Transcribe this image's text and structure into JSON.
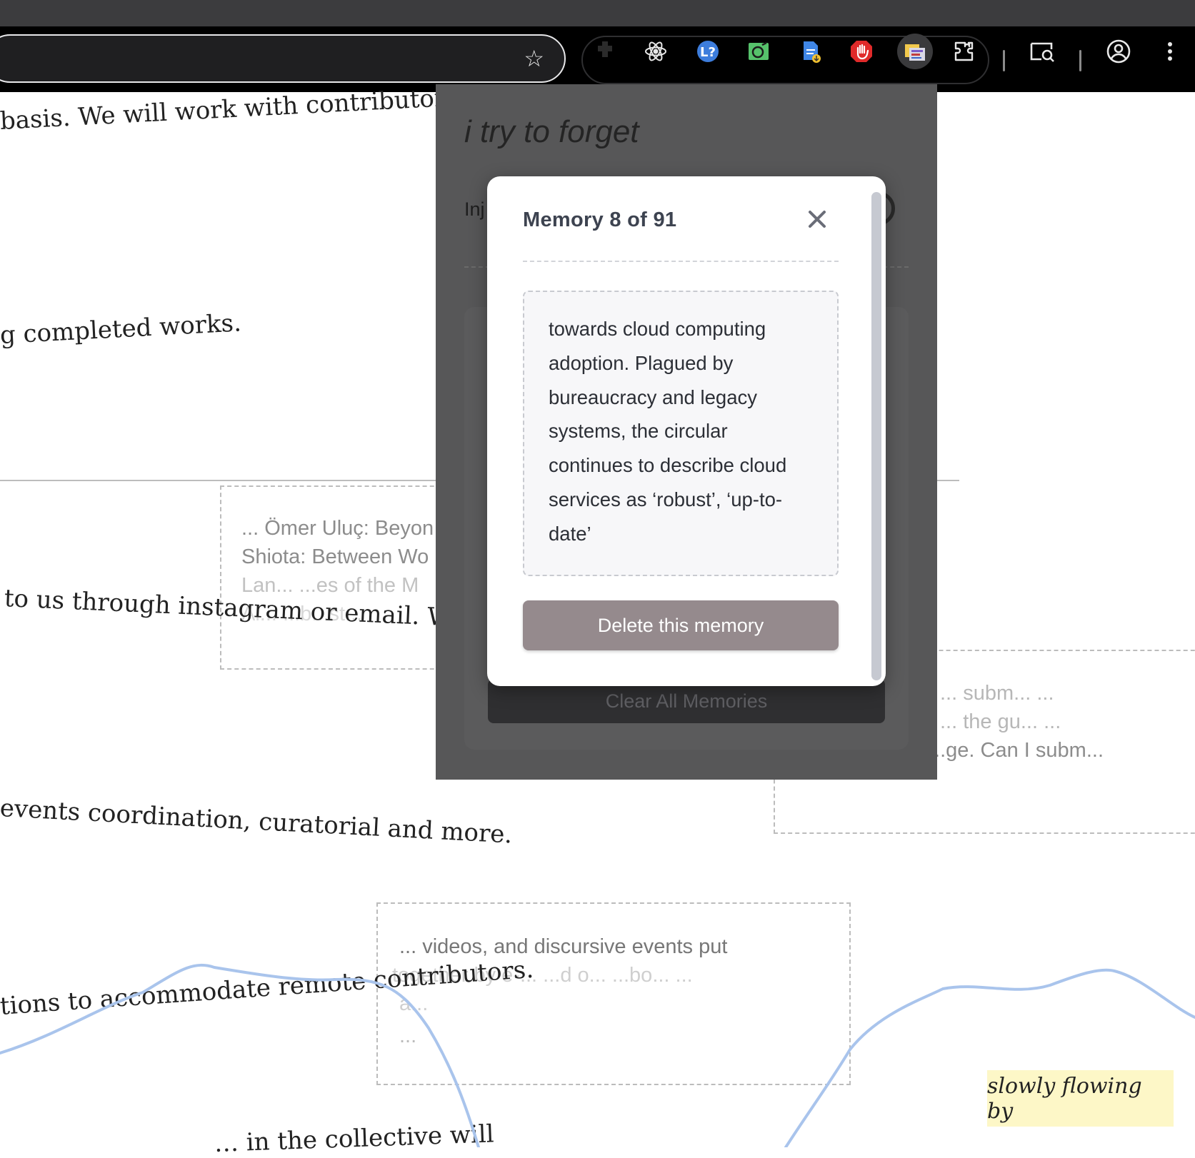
{
  "browser": {
    "toolbar_icons": [
      "extensions-puzzle-icon",
      "react-devtools-icon",
      "lastpass-icon",
      "screenshot-extension-icon",
      "document-download-icon",
      "adblock-hand-icon",
      "active-extension-icon",
      "extensions-menu-icon",
      "tab-search-icon",
      "profile-icon",
      "more-menu-icon"
    ],
    "bookmark_icon": "star-icon",
    "active_extension_highlight": "#3a3a3c"
  },
  "page": {
    "lines": [
      "basis. We will work with contributors to",
      "g completed works.",
      "to us through instagram or email. We'll",
      "events coordination, curatorial and more.",
      "tions to accommodate remote contributors.",
      "… in the collective will"
    ],
    "overlay_snippets": {
      "box1": [
        "... Ömer Uluç: Beyon",
        "Shiota: Between Wo",
        "Lan... ...es of the M",
        "Ai... ...b...st..."
      ],
      "box2": [
        "... videos, and discursive events put",
        "together by e-... ...d o... ...bo... ...",
        "a...",
        "..."
      ],
      "box3": [
        "... subm... ...",
        "... the gu... ...",
        "...ge. Can I subm..."
      ]
    },
    "sticker": "slowly flowing by",
    "river_color": "#a9c4ec",
    "sticker_color": "#fdf7c7"
  },
  "popup": {
    "title": "i try to forget",
    "inject_label": "Inj",
    "clear_all_label": "Clear All Memories"
  },
  "modal": {
    "title": "Memory 8 of 91",
    "close_icon": "close-x-icon",
    "memory_text": "towards cloud computing adoption. Plagued by bureaucracy and legacy systems, the circular continues to describe cloud services as ‘robust’, ‘up-to-date’",
    "delete_label": "Delete this memory",
    "delete_color": "#958a8d"
  }
}
